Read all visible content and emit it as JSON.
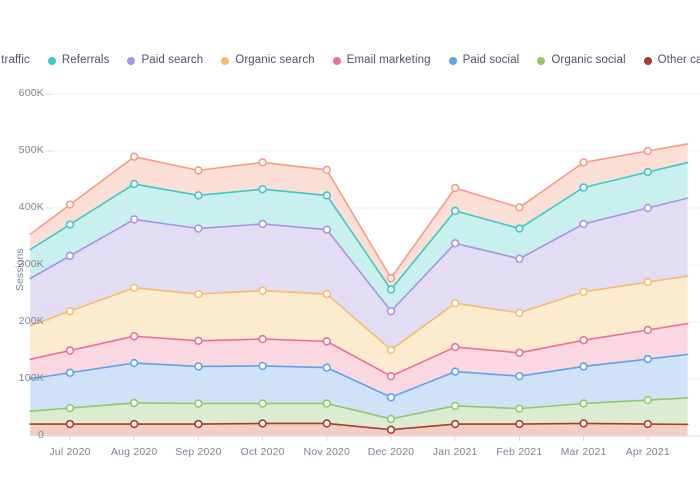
{
  "legend": {
    "position": "top",
    "items": [
      {
        "label": "Direct traffic",
        "color": "#f79b85",
        "fill": "#fbded5",
        "key": "direct_traffic"
      },
      {
        "label": "Referrals",
        "color": "#3ec9c2",
        "fill": "#c9f0ee",
        "key": "referrals"
      },
      {
        "label": "Paid search",
        "color": "#a894e0",
        "fill": "#e2dcf5",
        "key": "paid_search"
      },
      {
        "label": "Organic search",
        "color": "#f5bd6b",
        "fill": "#fcebcf",
        "key": "organic_search"
      },
      {
        "label": "Email marketing",
        "color": "#ec6f96",
        "fill": "#fad7e1",
        "key": "email_marketing"
      },
      {
        "label": "Paid social",
        "color": "#5fa3e8",
        "fill": "#cfe2f8",
        "key": "paid_social"
      },
      {
        "label": "Organic social",
        "color": "#8fc96a",
        "fill": "#dcecd0",
        "key": "organic_social"
      },
      {
        "label": "Other campaigns",
        "color": "#b03a28",
        "fill": "#f2cfc5",
        "key": "other_campaigns"
      }
    ]
  },
  "axes": {
    "y_title": "Sessions",
    "y_ticks": [
      "0",
      "100K",
      "200K",
      "300K",
      "400K",
      "500K",
      "600K"
    ],
    "y_tick_values": [
      0,
      100000,
      200000,
      300000,
      400000,
      500000,
      600000
    ],
    "y_min": 0,
    "y_max": 600000,
    "x_ticks": [
      "Jul 2020",
      "Aug 2020",
      "Sep 2020",
      "Oct 2020",
      "Nov 2020",
      "Dec 2020",
      "Jan 2021",
      "Feb 2021",
      "Mar 2021",
      "Apr 2021"
    ]
  },
  "style": {
    "grid_color": "#eceff3",
    "axis_line_color": "#d7dbe2",
    "tick_text_color": "#7b8494",
    "background": "#ffffff",
    "marker_fill": "#ffffff"
  },
  "chart_data": {
    "type": "area",
    "stacked": true,
    "title": "",
    "xlabel": "",
    "ylabel": "Sessions",
    "ylim": [
      0,
      600000
    ],
    "grid": true,
    "legend_position": "top",
    "categories": [
      "Jul 2020",
      "Aug 2020",
      "Sep 2020",
      "Oct 2020",
      "Nov 2020",
      "Dec 2020",
      "Jan 2021",
      "Feb 2021",
      "Mar 2021",
      "Apr 2021"
    ],
    "series": [
      {
        "name": "Other campaigns",
        "values": [
          21000,
          21000,
          21000,
          22000,
          22000,
          11000,
          21000,
          21000,
          22000,
          21000
        ]
      },
      {
        "name": "Organic social",
        "values": [
          28000,
          37000,
          36000,
          35000,
          35000,
          19000,
          32000,
          27000,
          35000,
          42000
        ]
      },
      {
        "name": "Paid social",
        "values": [
          62000,
          70000,
          65000,
          66000,
          63000,
          38000,
          60000,
          57000,
          65000,
          72000
        ]
      },
      {
        "name": "Email marketing",
        "values": [
          39000,
          47000,
          45000,
          47000,
          46000,
          37000,
          43000,
          41000,
          46000,
          51000
        ]
      },
      {
        "name": "Organic search",
        "values": [
          69000,
          85000,
          82000,
          85000,
          83000,
          46000,
          77000,
          70000,
          85000,
          84000
        ]
      },
      {
        "name": "Paid search",
        "values": [
          97000,
          120000,
          115000,
          117000,
          113000,
          68000,
          105000,
          95000,
          119000,
          130000
        ]
      },
      {
        "name": "Referrals",
        "values": [
          55000,
          62000,
          58000,
          61000,
          60000,
          38000,
          57000,
          53000,
          64000,
          63000
        ]
      },
      {
        "name": "Direct traffic",
        "values": [
          35000,
          48000,
          44000,
          47000,
          45000,
          20000,
          40000,
          37000,
          44000,
          37000
        ]
      }
    ],
    "cumulative_totals": [
      406000,
      490000,
      466000,
      480000,
      467000,
      277000,
      435000,
      401000,
      480000,
      500000
    ],
    "stack_order_bottom_to_top": [
      "Other campaigns",
      "Organic social",
      "Paid social",
      "Email marketing",
      "Organic search",
      "Paid search",
      "Referrals",
      "Direct traffic"
    ]
  }
}
